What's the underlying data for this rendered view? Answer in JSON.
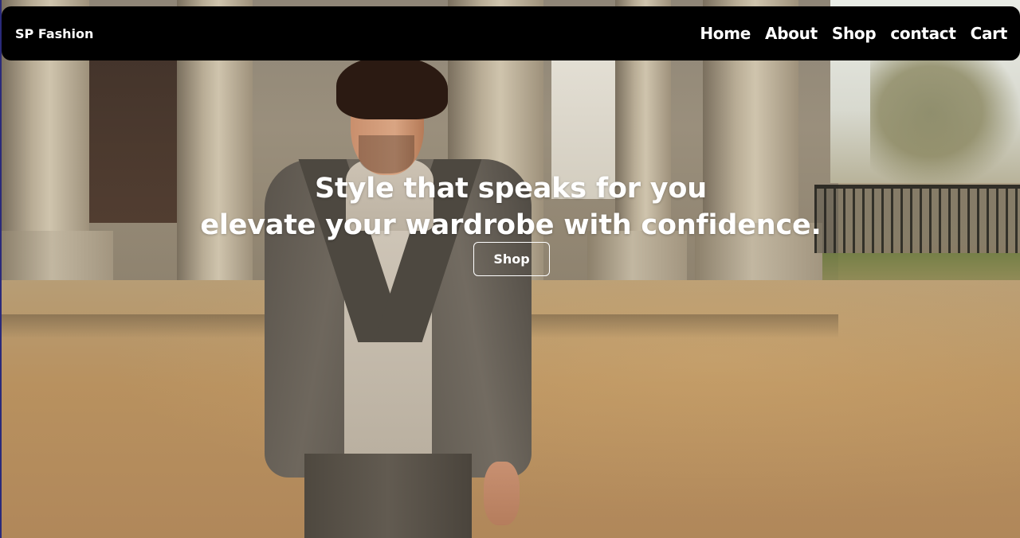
{
  "navbar": {
    "brand": "SP Fashion",
    "links": [
      "Home",
      "About",
      "Shop",
      "contact",
      "Cart"
    ]
  },
  "hero": {
    "headline_line1": "Style that speaks for you",
    "headline_line2": "elevate your wardrobe with confidence.",
    "cta_label": "Shop"
  },
  "colors": {
    "navbar_bg": "#000000",
    "text": "#ffffff"
  }
}
